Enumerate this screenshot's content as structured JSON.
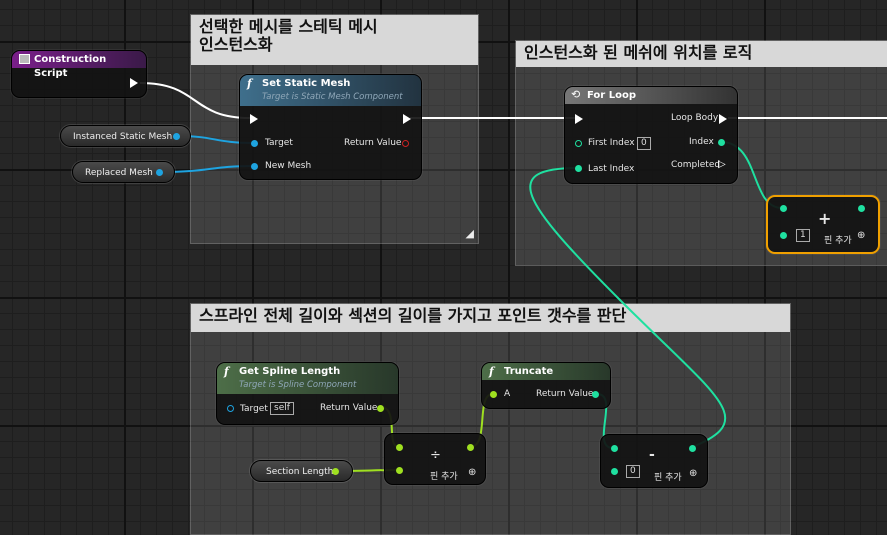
{
  "comments": {
    "c1_title": "선택한 메시를 스테틱 메시\n인스턴스화",
    "c2_title": "인스턴스화 된 메쉬에 위치를 로직",
    "c3_title": "스프라인 전체 길이와 섹션의 길이를 가지고 포인트 갯수를 판단"
  },
  "construction_script": {
    "title": "Construction Script"
  },
  "set_static_mesh": {
    "title": "Set Static Mesh",
    "subtitle": "Target is Static Mesh Component",
    "target": "Target",
    "new_mesh": "New Mesh",
    "return_value": "Return Value"
  },
  "variables": {
    "instanced": "Instanced Static Mesh",
    "replaced": "Replaced Mesh",
    "section_length": "Section Length"
  },
  "for_loop": {
    "title": "For Loop",
    "first_index": "First Index",
    "first_index_value": "0",
    "last_index": "Last Index",
    "loop_body": "Loop Body",
    "index": "Index",
    "completed": "Completed"
  },
  "add_node": {
    "symbol": "+",
    "value": "1",
    "add_pin": "핀 추가"
  },
  "get_spline_length": {
    "title": "Get Spline Length",
    "subtitle": "Target is Spline Component",
    "target": "Target",
    "target_value": "self",
    "return_value": "Return Value"
  },
  "truncate": {
    "title": "Truncate",
    "a": "A",
    "return_value": "Return Value"
  },
  "divide_node": {
    "symbol": "÷",
    "add_pin": "핀 추가"
  },
  "subtract_node": {
    "symbol": "-",
    "value": "0",
    "add_pin": "핀 추가"
  },
  "colors": {
    "exec": "#ffffff",
    "object_pin": "#1ea3e0",
    "int_pin": "#1fe0a0",
    "float_pin": "#9fe020",
    "selected_border": "#f0a000"
  }
}
